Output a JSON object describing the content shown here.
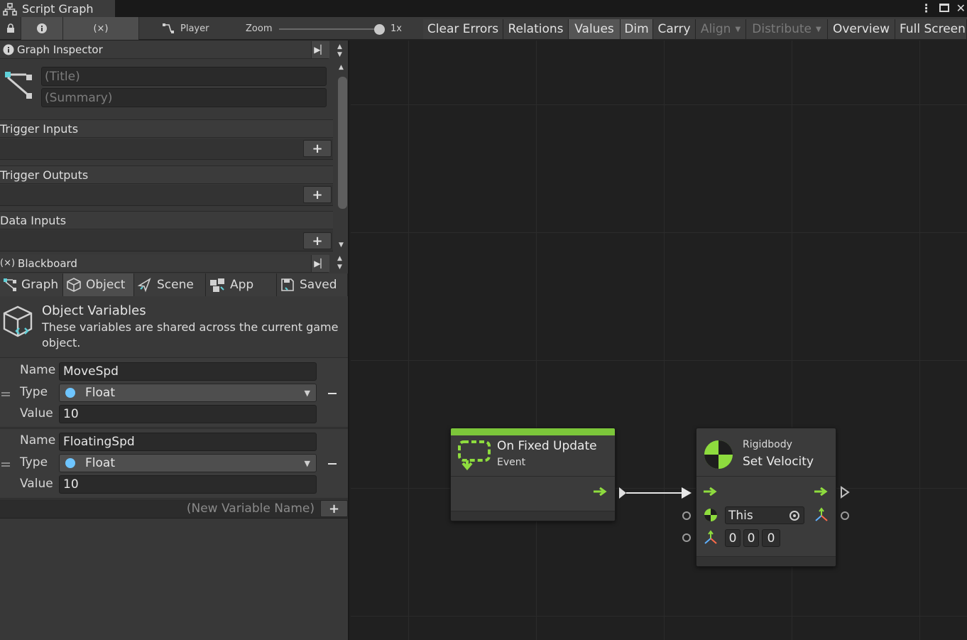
{
  "window": {
    "title": "Script Graph"
  },
  "toolbar": {
    "player_label": "Player",
    "zoom_label": "Zoom",
    "zoom_value": "1x",
    "zoom_level": 1.0,
    "buttons": {
      "clear_errors": "Clear Errors",
      "relations": "Relations",
      "values": "Values",
      "dim": "Dim",
      "carry": "Carry",
      "align": "Align",
      "distribute": "Distribute",
      "overview": "Overview",
      "full_screen": "Full Screen"
    }
  },
  "graph_inspector": {
    "header": "Graph Inspector",
    "title_placeholder": "(Title)",
    "summary_placeholder": "(Summary)",
    "sections": [
      "Trigger Inputs",
      "Trigger Outputs",
      "Data Inputs"
    ]
  },
  "blackboard": {
    "header": "Blackboard",
    "header_icon_text": "(×)",
    "tabs": [
      "Graph",
      "Object",
      "Scene",
      "App",
      "Saved"
    ],
    "active_tab": "Object",
    "section_title": "Object Variables",
    "section_description": "These variables are shared across the current game object.",
    "field_labels": {
      "name": "Name",
      "type": "Type",
      "value": "Value"
    },
    "variables": [
      {
        "name": "MoveSpd",
        "type": "Float",
        "value": "10"
      },
      {
        "name": "FloatingSpd",
        "type": "Float",
        "value": "10"
      }
    ],
    "new_variable_placeholder": "(New Variable Name)"
  },
  "graph": {
    "nodes": {
      "event": {
        "title": "On Fixed Update",
        "subtitle": "Event"
      },
      "action": {
        "category": "Rigidbody",
        "title": "Set Velocity",
        "target_value": "This",
        "velocity": [
          "0",
          "0",
          "0"
        ]
      }
    }
  },
  "colors": {
    "accent_green": "#7cc63a",
    "float_dot": "#6ec5ff",
    "canvas_bg": "#202020",
    "panel_bg": "#383838"
  }
}
